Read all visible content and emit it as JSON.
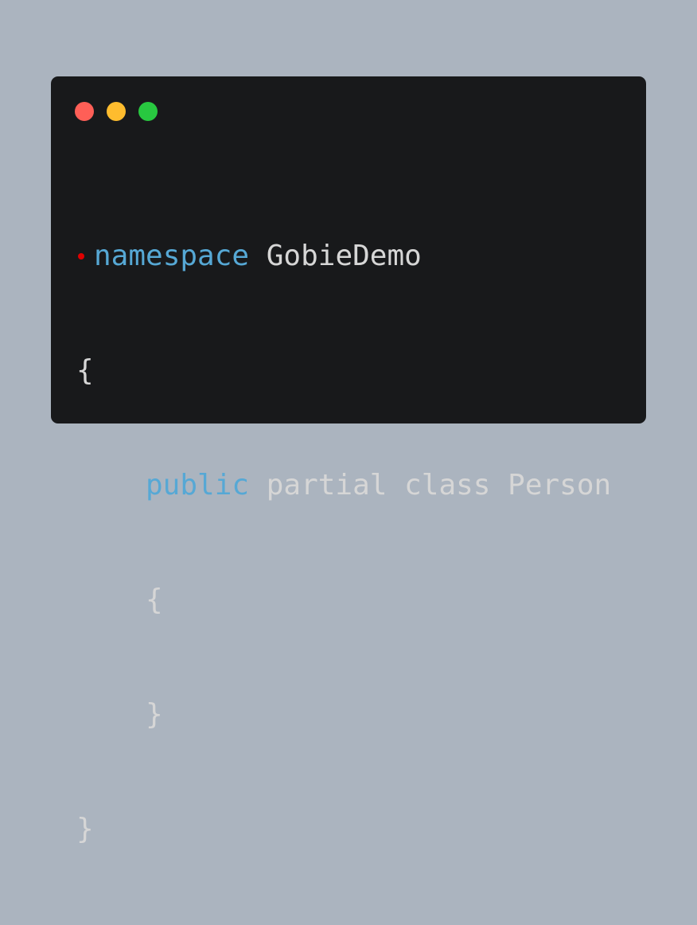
{
  "window": {
    "traffic_lights": [
      {
        "name": "close",
        "color": "#ff5f57"
      },
      {
        "name": "minimize",
        "color": "#febc2e"
      },
      {
        "name": "maximize",
        "color": "#28c840"
      }
    ]
  },
  "code": {
    "line1_keyword": "namespace",
    "line1_rest": " GobieDemo",
    "line2": "{",
    "line3_keyword": "public",
    "line3_rest": " partial class Person",
    "line4": "{",
    "line5": "}",
    "line6": "}",
    "marker_color": "#e00000"
  },
  "colors": {
    "background": "#abb4bf",
    "window_bg": "#18191b",
    "text": "#d6d6d6",
    "keyword": "#56a8d5"
  }
}
